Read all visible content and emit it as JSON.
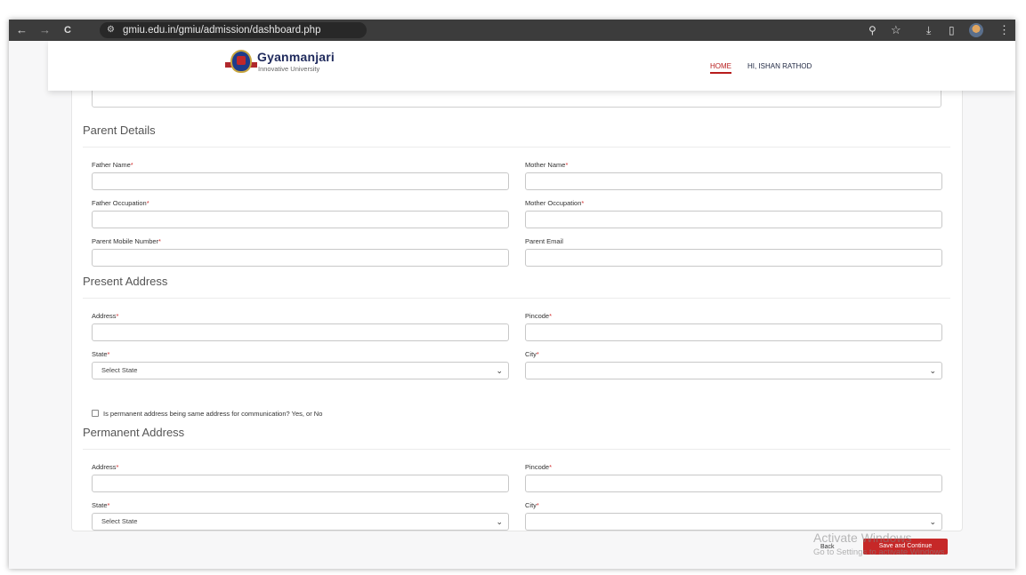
{
  "browser": {
    "back_glyph": "←",
    "forward_glyph": "→",
    "reload_glyph": "C",
    "site_info_glyph": "⚙",
    "url": "gmiu.edu.in/gmiu/admission/dashboard.php",
    "zoom_glyph": "⚲",
    "bookmark_glyph": "☆",
    "download_glyph": "⤓",
    "sidebar_glyph": "▯",
    "menu_glyph": "⋮"
  },
  "header": {
    "logo_title": "Gyanmanjari",
    "logo_subtitle": "Innovative University",
    "nav_home": "HOME",
    "nav_user": "HI, ISHAN RATHOD",
    "accent_color": "#b71c1c"
  },
  "parent_details": {
    "title": "Parent Details",
    "father_name_label": "Father Name",
    "mother_name_label": "Mother Name",
    "father_occupation_label": "Father Occupation",
    "mother_occupation_label": "Mother Occupation",
    "parent_mobile_label": "Parent Mobile Number",
    "parent_email_label": "Parent Email"
  },
  "present_address": {
    "title": "Present Address",
    "address_label": "Address",
    "pincode_label": "Pincode",
    "state_label": "State",
    "state_selected": "Select State",
    "city_label": "City",
    "city_selected": "",
    "same_address_checkbox_label": "Is permanent address being same address for communication? Yes, or No",
    "same_address_checked": false
  },
  "permanent_address": {
    "title": "Permanent Address",
    "address_label": "Address",
    "pincode_label": "Pincode",
    "state_label": "State",
    "state_selected": "Select State",
    "city_label": "City",
    "city_selected": ""
  },
  "required_marker": "*",
  "chevron_glyph": "⌄",
  "actions": {
    "back_label": "Back",
    "save_label": "Save and Continue",
    "primary_color": "#c62828"
  },
  "watermark": {
    "line1": "Activate Windows",
    "line2": "Go to Settings to activate Windows."
  }
}
